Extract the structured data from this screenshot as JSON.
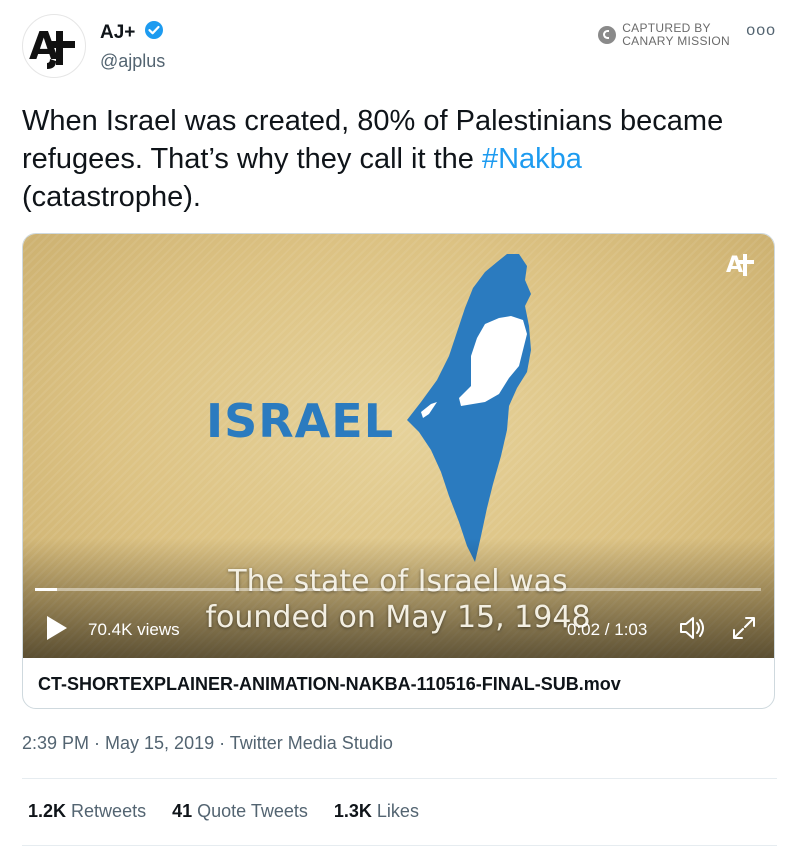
{
  "account": {
    "name": "AJ+",
    "handle": "@ajplus",
    "avatar_icon": "ajplus-logo",
    "verified_icon": "verified-badge-icon"
  },
  "watermark": {
    "line1": "CAPTURED BY",
    "line2": "CANARY MISSION"
  },
  "more_label": "ooo",
  "tweet": {
    "text_before": "When Israel was created, 80% of Palestinians became refugees. That’s why they call it the ",
    "hashtag": "#Nakba",
    "text_after": " (catastrophe)."
  },
  "video": {
    "map_label": "ISRAEL",
    "subtitle_line1": "The state of Israel was",
    "subtitle_line2": "founded on May 15, 1948",
    "views": "70.4K views",
    "time": "0:02 / 1:03",
    "progress": 0.03,
    "filename": "CT-SHORTEXPLAINER-ANIMATION-NAKBA-110516-FINAL-SUB.mov"
  },
  "meta": "2:39 PM · May 15, 2019 · Twitter Media Studio",
  "stats": {
    "retweets_count": "1.2K",
    "retweets_label": "Retweets",
    "quotes_count": "41",
    "quotes_label": "Quote Tweets",
    "likes_count": "1.3K",
    "likes_label": "Likes"
  },
  "colors": {
    "brand_blue": "#1d9bf0",
    "map_blue": "#2b7bbf",
    "video_bg": "#dcc283"
  }
}
